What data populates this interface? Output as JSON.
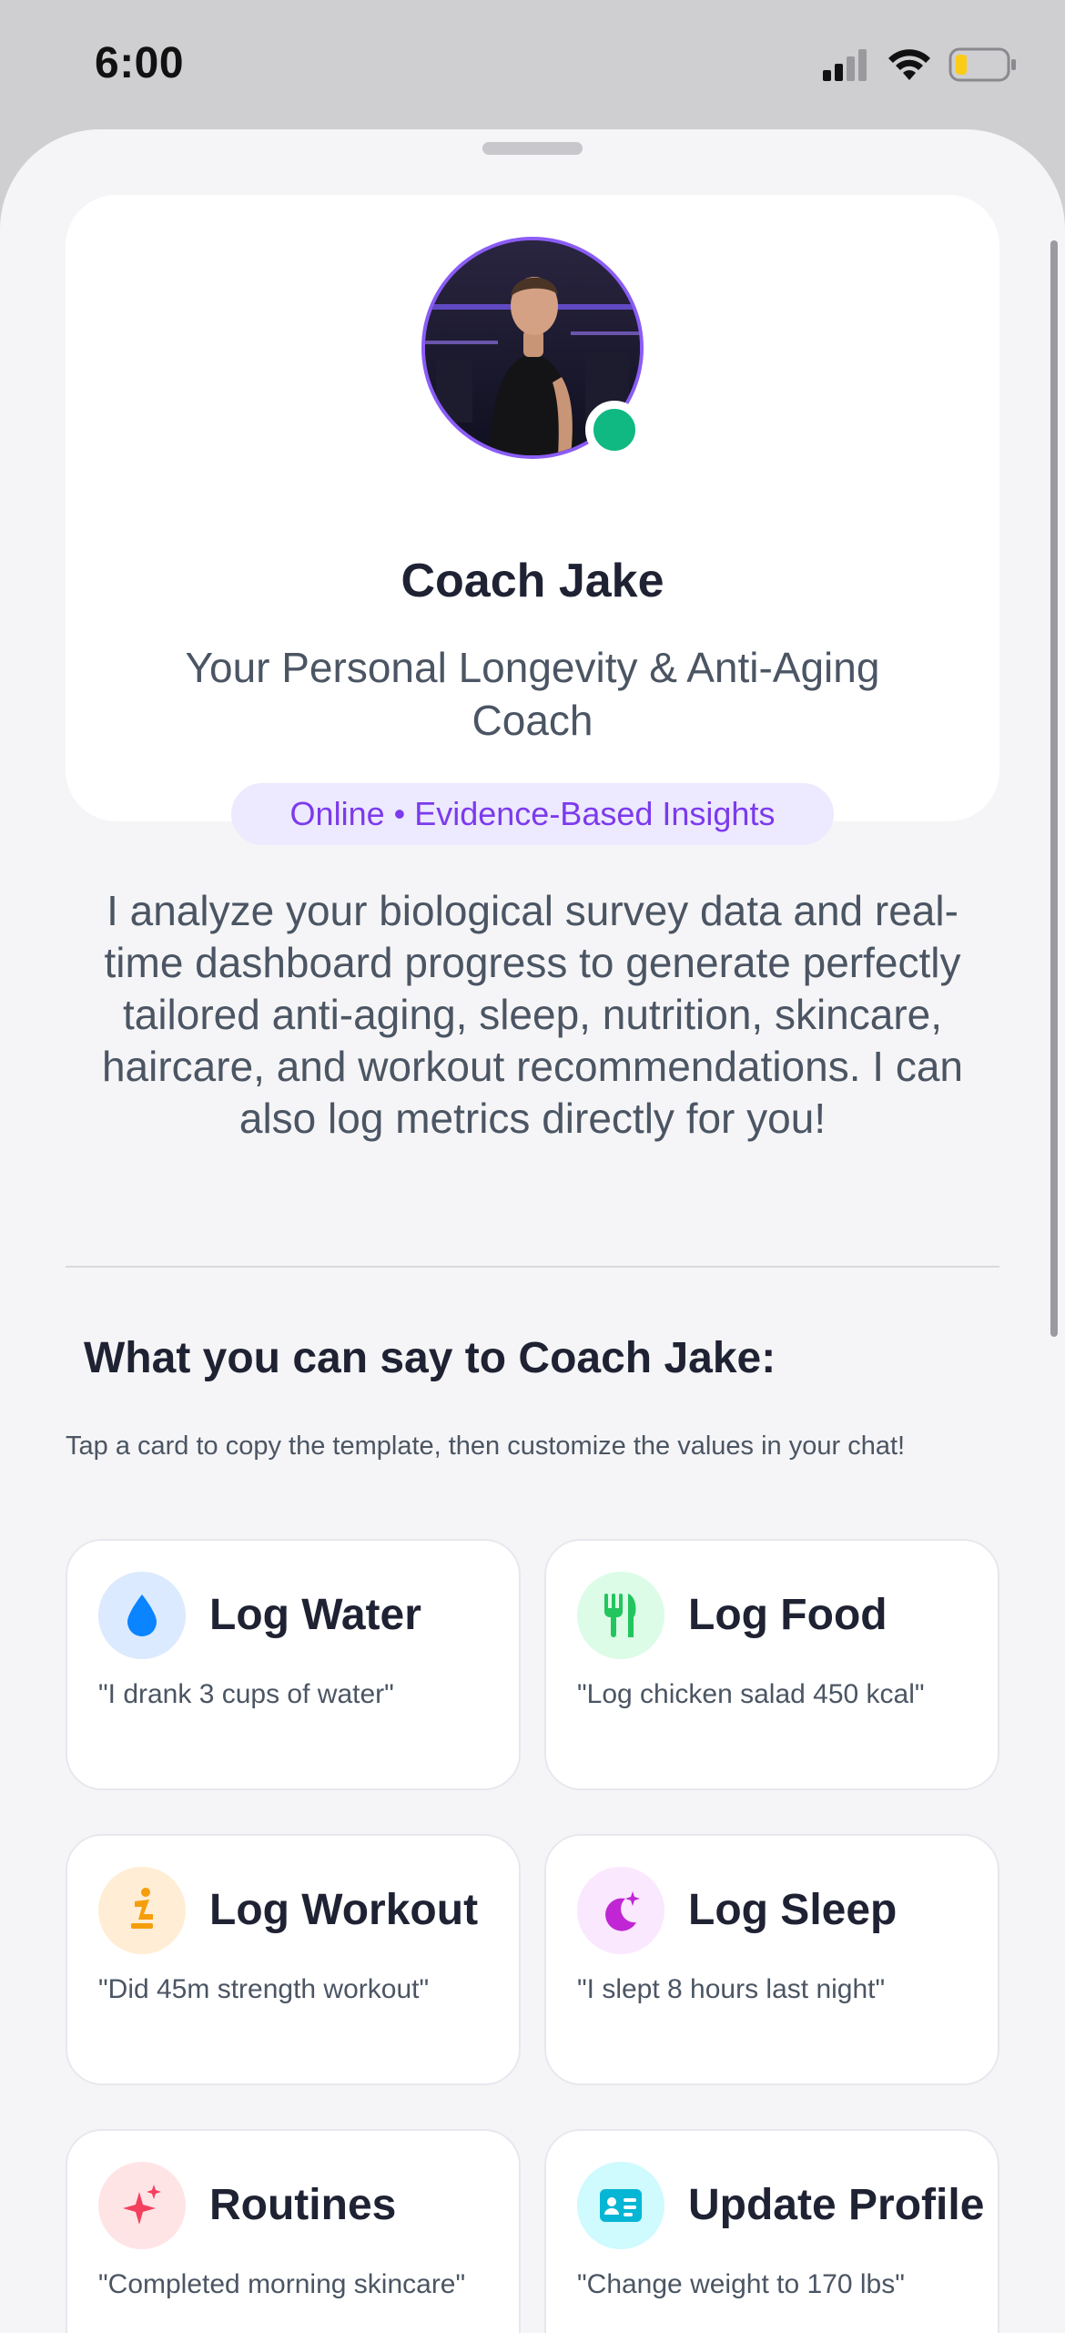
{
  "status_bar": {
    "time": "6:00"
  },
  "coach": {
    "name": "Coach Jake",
    "subtitle": "Your Personal Longevity & Anti-Aging Coach",
    "status": "Online • Evidence-Based Insights"
  },
  "intro": "I analyze your biological survey data and real-time dashboard progress to generate perfectly tailored anti-aging, sleep, nutrition, skincare, haircare, and workout recommendations. I can also log metrics directly for you!",
  "section": {
    "title": "What you can say to Coach Jake:",
    "hint": "Tap a card to copy the template, then customize the values in your chat!"
  },
  "cards": [
    {
      "title": "Log Water",
      "example": "\"I drank 3 cups of water\"",
      "icon": "water-drop-icon",
      "icon_color": "#0a84ff",
      "icon_bg": "#dbeafe"
    },
    {
      "title": "Log Food",
      "example": "\"Log chicken salad 450 kcal\"",
      "icon": "fork-knife-icon",
      "icon_color": "#22c55e",
      "icon_bg": "#dcfce7"
    },
    {
      "title": "Log Workout",
      "example": "\"Did 45m strength workout\"",
      "icon": "workout-figure-icon",
      "icon_color": "#f59e0b",
      "icon_bg": "#ffedd5"
    },
    {
      "title": "Log Sleep",
      "example": "\"I slept 8 hours last night\"",
      "icon": "moon-stars-icon",
      "icon_color": "#c026d3",
      "icon_bg": "#fae8ff"
    },
    {
      "title": "Routines",
      "example": "\"Completed morning skincare\"",
      "icon": "sparkles-icon",
      "icon_color": "#f43f5e",
      "icon_bg": "#ffe4e6"
    },
    {
      "title": "Update Profile",
      "example": "\"Change weight to 170 lbs\"",
      "icon": "id-card-icon",
      "icon_color": "#06b6d4",
      "icon_bg": "#cffafe"
    }
  ],
  "colors": {
    "accent_purple": "#7c3aed",
    "online_green": "#10b981",
    "background": "#f5f5f7"
  }
}
